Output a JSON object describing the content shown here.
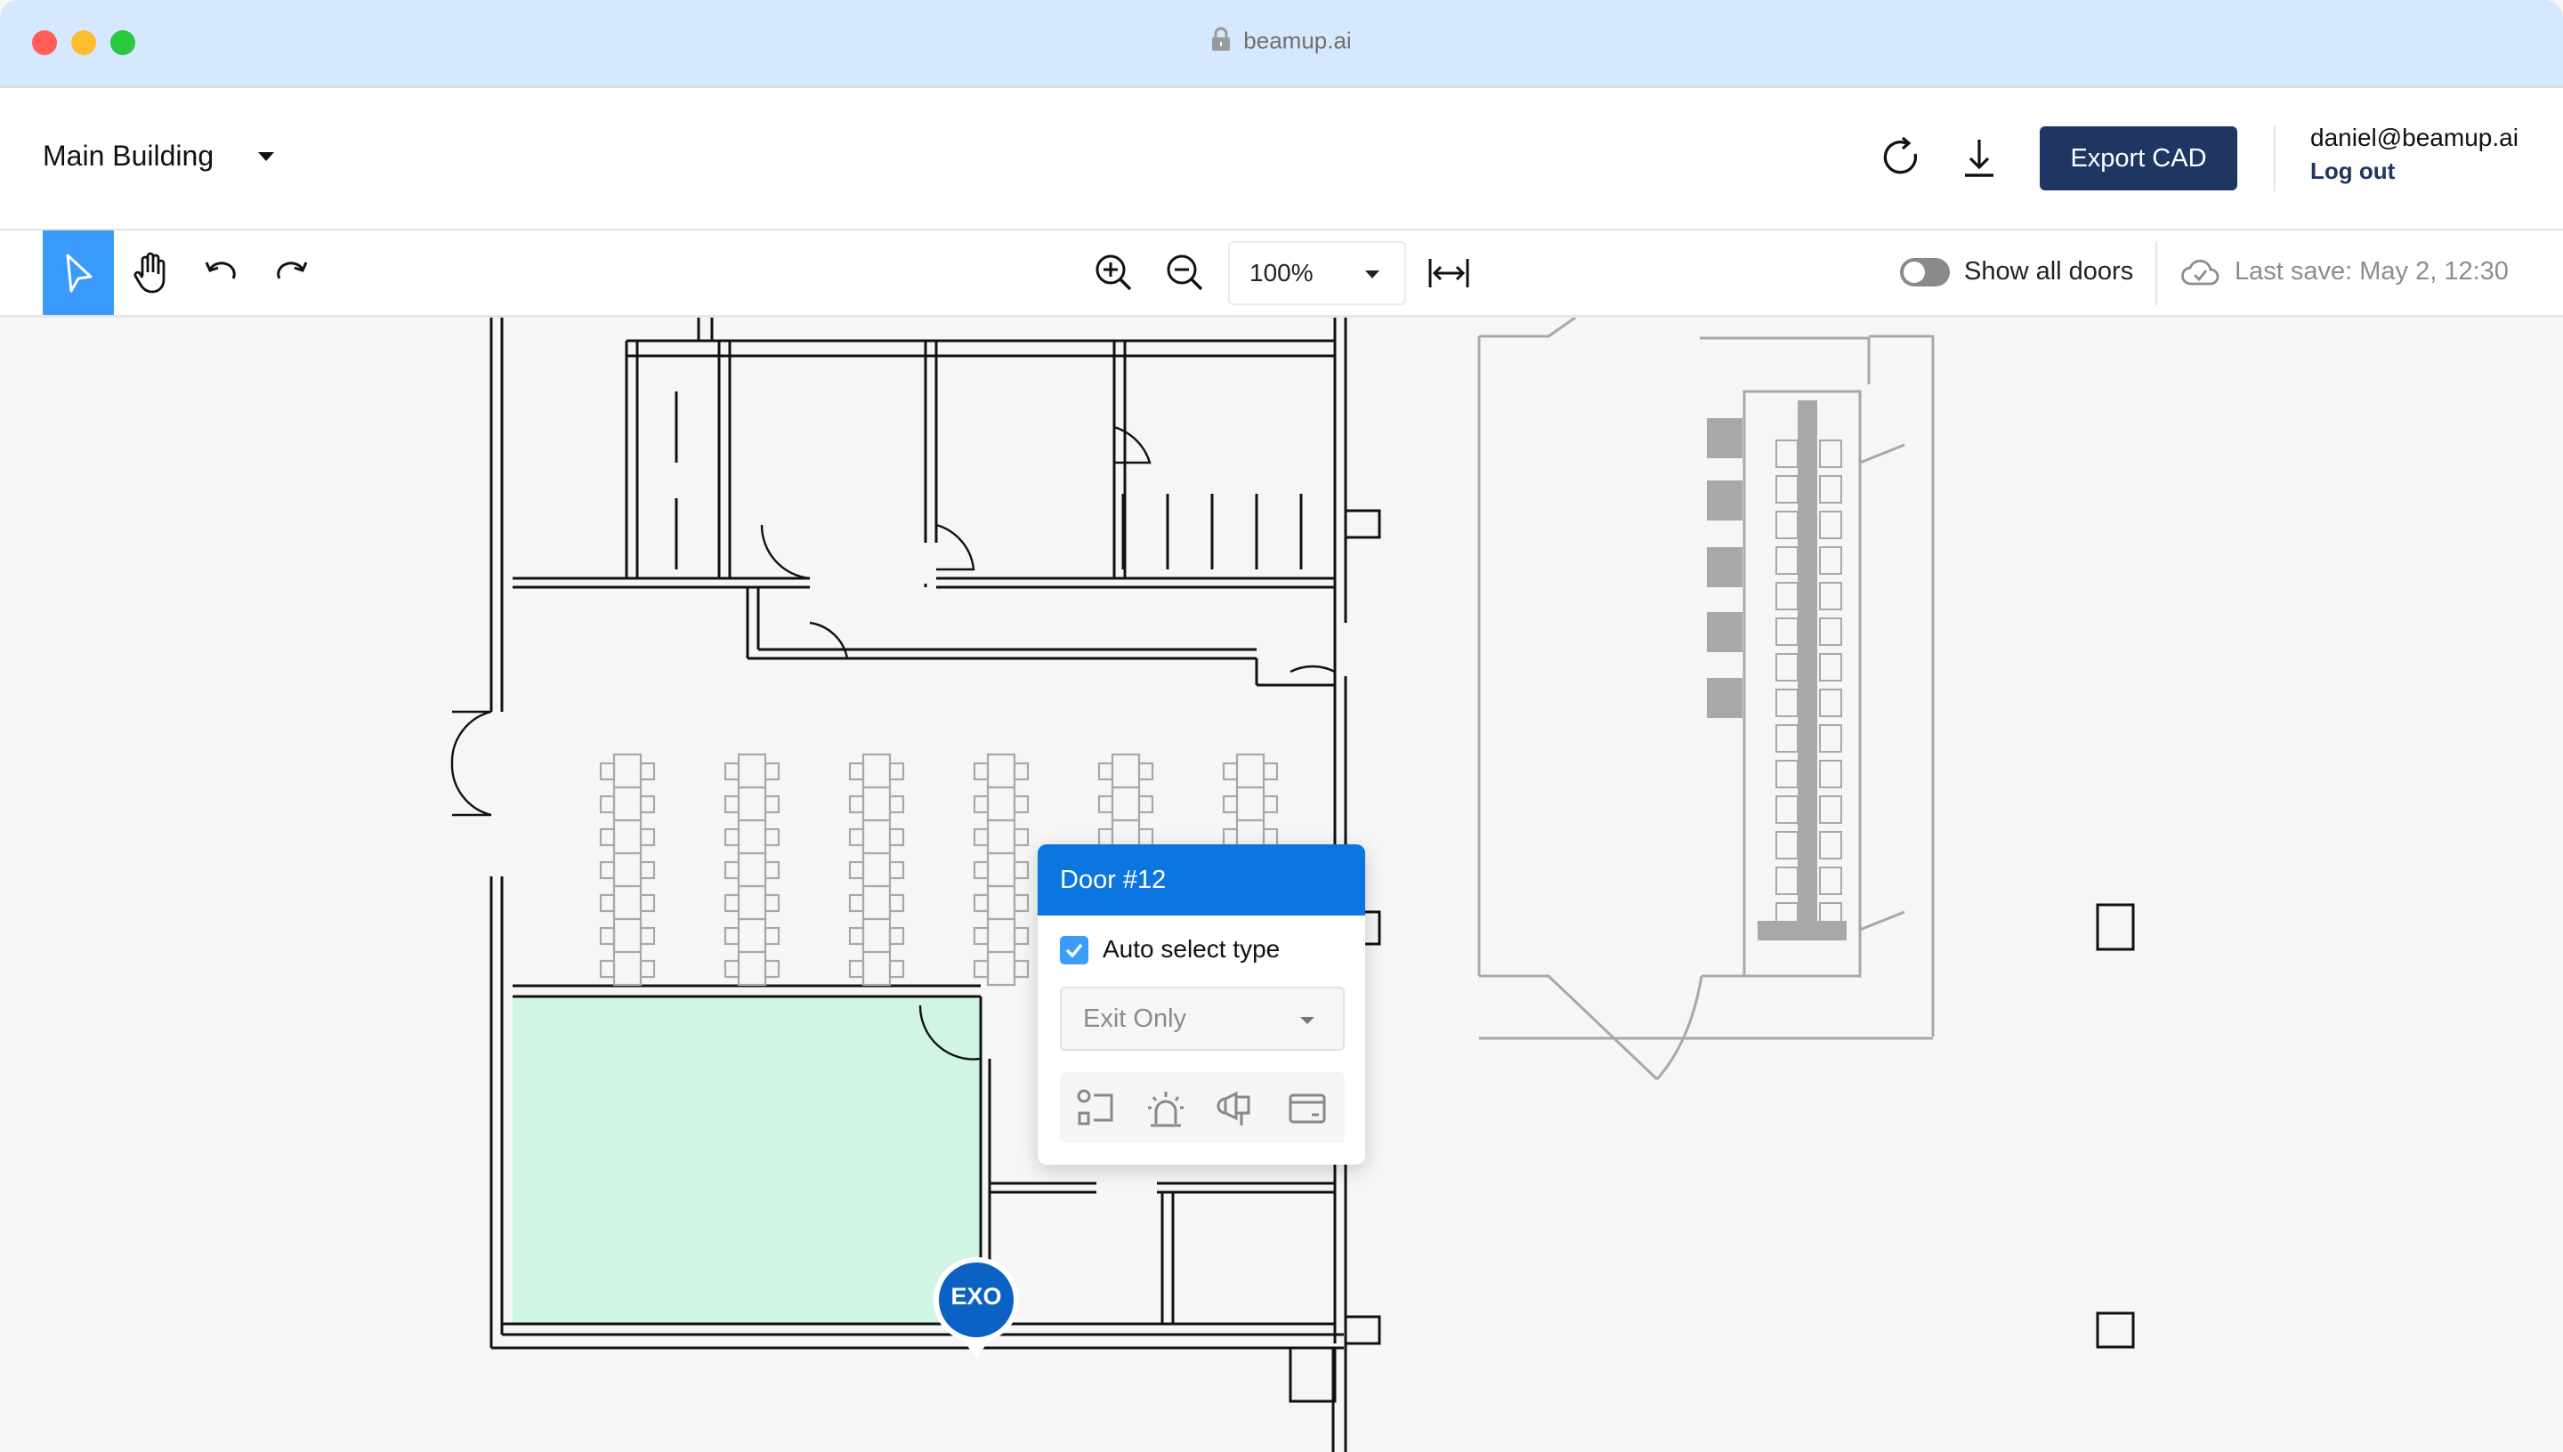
{
  "browser": {
    "url": "beamup.ai",
    "lock_icon": "lock-icon",
    "traffic_lights": {
      "close": "#ff5f57",
      "minimize": "#febc2e",
      "zoom": "#28c840"
    }
  },
  "header": {
    "building_selector": "Main Building",
    "refresh_icon": "refresh-icon",
    "download_icon": "download-icon",
    "export_label": "Export CAD",
    "user_email": "daniel@beamup.ai",
    "logout_label": "Log out"
  },
  "toolbar": {
    "tools": [
      {
        "name": "select",
        "icon": "cursor-arrow-icon",
        "active": true
      },
      {
        "name": "pan",
        "icon": "hand-icon",
        "active": false
      },
      {
        "name": "undo",
        "icon": "undo-icon",
        "active": false
      },
      {
        "name": "redo",
        "icon": "redo-icon",
        "active": false
      }
    ],
    "zoom_in_icon": "zoom-in-icon",
    "zoom_out_icon": "zoom-out-icon",
    "zoom_level": "100%",
    "fit_width_icon": "fit-width-icon",
    "show_all_doors_label": "Show all doors",
    "show_all_doors_on": false,
    "last_save": "Last save: May 2, 12:30",
    "cloud_icon": "cloud-check-icon"
  },
  "canvas": {
    "selected_room_color": "#d0f5e4",
    "door_pin": {
      "label": "EXO",
      "color": "#0b62c4"
    },
    "door_popup": {
      "title": "Door #12",
      "auto_select_label": "Auto select type",
      "auto_select_checked": true,
      "type_value": "Exit Only",
      "device_icons": [
        "card-reader-icon",
        "alarm-siren-icon",
        "horn-speaker-icon",
        "access-card-icon"
      ]
    }
  },
  "colors": {
    "accent": "#3a9bfd",
    "popup_header": "#0b76e0",
    "primary_button": "#1f3663",
    "titlebar": "#d5e8fd"
  }
}
